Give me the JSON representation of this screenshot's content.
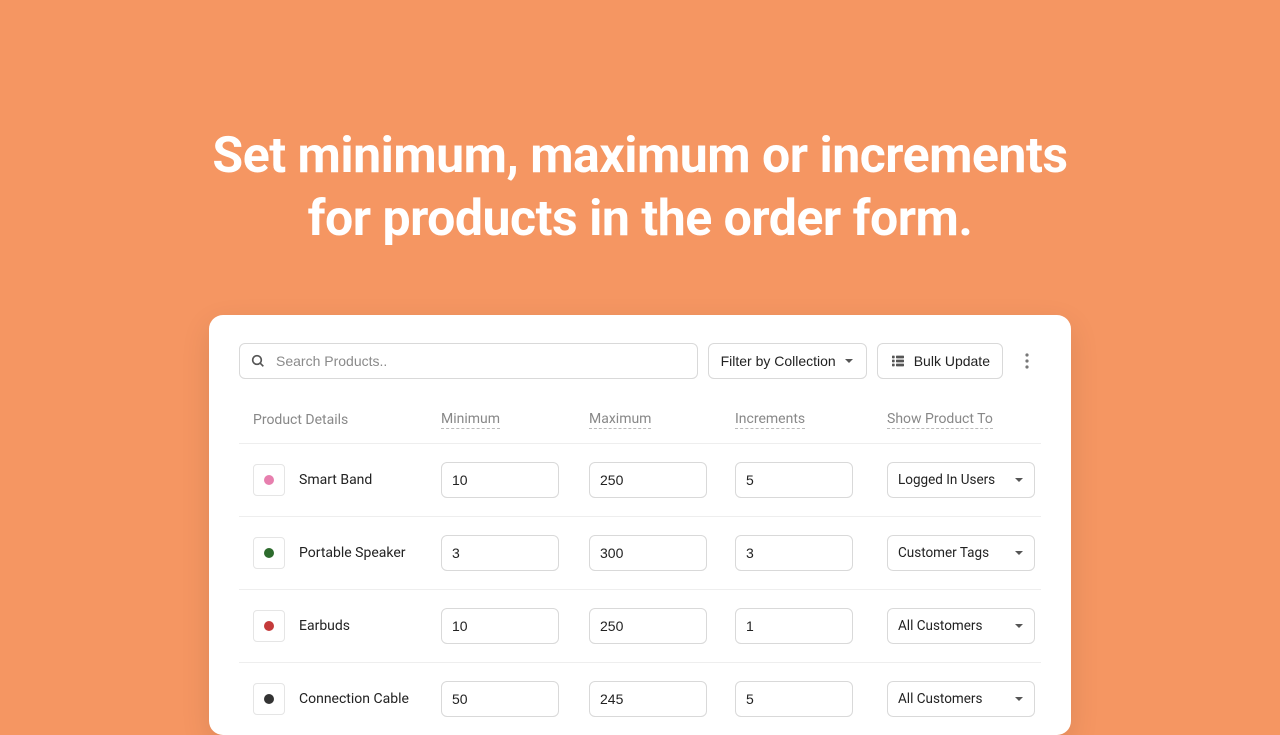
{
  "hero": {
    "title_line1": "Set minimum, maximum or increments",
    "title_line2": "for products in the order form."
  },
  "toolbar": {
    "search_placeholder": "Search Products..",
    "filter_label": "Filter by Collection",
    "bulk_label": "Bulk Update"
  },
  "columns": {
    "product": "Product Details",
    "min": "Minimum",
    "max": "Maximum",
    "inc": "Increments",
    "show": "Show Product To"
  },
  "rows": [
    {
      "name": "Smart Band",
      "min": "10",
      "max": "250",
      "inc": "5",
      "show": "Logged In Users",
      "thumb_color": "#e77fae"
    },
    {
      "name": "Portable Speaker",
      "min": "3",
      "max": "300",
      "inc": "3",
      "show": "Customer Tags",
      "thumb_color": "#2d6b2d"
    },
    {
      "name": "Earbuds",
      "min": "10",
      "max": "250",
      "inc": "1",
      "show": "All Customers",
      "thumb_color": "#c43a3a"
    },
    {
      "name": "Connection Cable",
      "min": "50",
      "max": "245",
      "inc": "5",
      "show": "All Customers",
      "thumb_color": "#333333"
    }
  ]
}
